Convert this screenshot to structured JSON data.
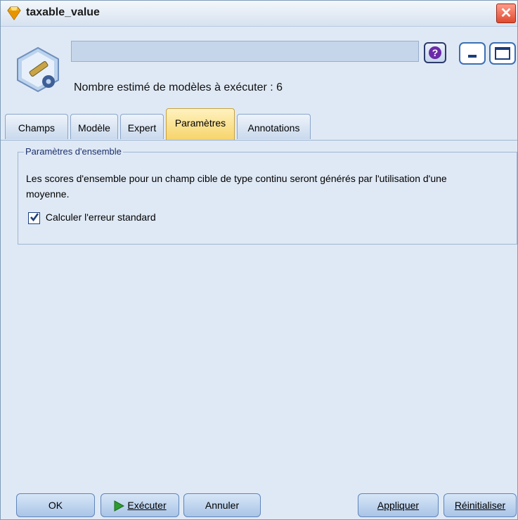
{
  "window": {
    "title": "taxable_value",
    "close_glyph": "✕"
  },
  "header": {
    "name_value": "",
    "estimate_text": "Nombre estimé de modèles à exécuter : 6",
    "help_glyph": "?"
  },
  "tabs": [
    {
      "label": "Champs",
      "active": false
    },
    {
      "label": "Modèle",
      "active": false
    },
    {
      "label": "Expert",
      "active": false
    },
    {
      "label": "Paramètres",
      "active": true
    },
    {
      "label": "Annotations",
      "active": false
    }
  ],
  "settings": {
    "group_title": "Paramètres d'ensemble",
    "description": "Les scores d'ensemble pour un champ cible de type continu seront générés par l'utilisation d'une moyenne.",
    "checkbox_label": "Calculer l'erreur standard",
    "checkbox_checked": true
  },
  "buttons": {
    "ok": "OK",
    "execute": "Exécuter",
    "cancel": "Annuler",
    "apply": "Appliquer",
    "reset": "Réinitialiser"
  },
  "colors": {
    "background": "#dfe9f5",
    "active_tab": "#f7d46a",
    "close_button": "#e04a2e"
  }
}
